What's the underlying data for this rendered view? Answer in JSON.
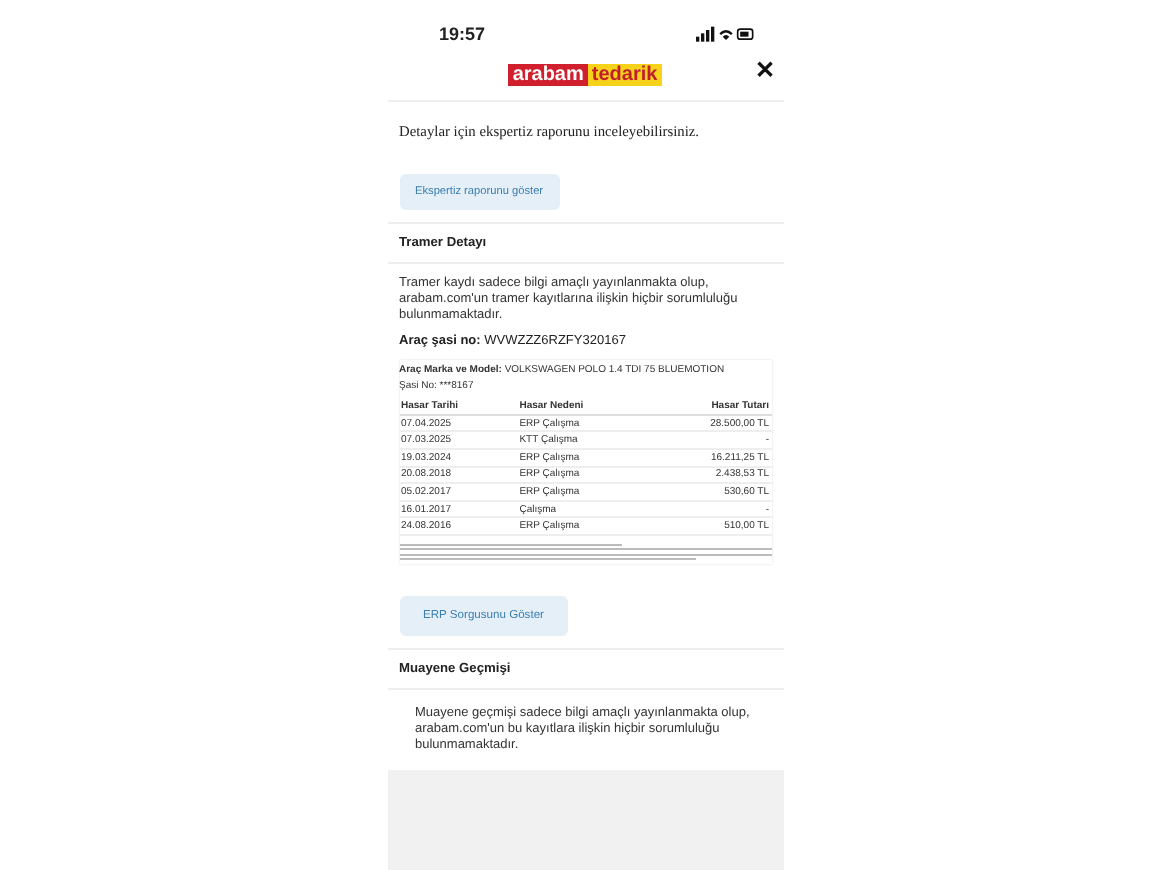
{
  "status_bar": {
    "time": "19:57"
  },
  "header": {
    "logo_left": "arabam",
    "logo_right": "tedarik",
    "close": "✕"
  },
  "intro": "Detaylar için ekspertiz raporunu inceleyebilirsiniz.",
  "expertise_button": "Ekspertiz raporunu göster",
  "tramer": {
    "title": "Tramer Detayı",
    "note": "Tramer kaydı sadece bilgi amaçlı yayınlanmakta olup, arabam.com'un tramer kayıtlarına ilişkin hiçbir sorumluluğu bulunmamaktadır.",
    "chassis_label": "Araç şasi no:",
    "chassis_value": "WVWZZZ6RZFY320167"
  },
  "report": {
    "model_label": "Araç Marka ve Model:",
    "model_value": "VOLKSWAGEN POLO 1.4 TDI 75 BLUEMOTION",
    "chassis_line": "Şasi No: ***8167",
    "columns": [
      "Hasar Tarihi",
      "Hasar Nedeni",
      "Hasar Tutarı"
    ],
    "rows": [
      {
        "date": "07.04.2025",
        "reason": "ERP Çalışma",
        "amount": "28.500,00 TL"
      },
      {
        "date": "07.03.2025",
        "reason": "KTT Çalışma",
        "amount": "-"
      },
      {
        "date": "19.03.2024",
        "reason": "ERP Çalışma",
        "amount": "16.211,25 TL"
      },
      {
        "date": "20.08.2018",
        "reason": "ERP Çalışma",
        "amount": "2.438,53 TL"
      },
      {
        "date": "05.02.2017",
        "reason": "ERP Çalışma",
        "amount": "530,60 TL"
      },
      {
        "date": "16.01.2017",
        "reason": "Çalışma",
        "amount": "-"
      },
      {
        "date": "24.08.2016",
        "reason": "ERP Çalışma",
        "amount": "510,00 TL"
      }
    ]
  },
  "erp_button": "ERP Sorgusunu Göster",
  "inspection": {
    "title": "Muayene Geçmişi",
    "note": "Muayene geçmişi sadece bilgi amaçlı yayınlanmakta olup, arabam.com'un bu kayıtlara ilişkin hiçbir sorumluluğu bulunmamaktadır."
  }
}
